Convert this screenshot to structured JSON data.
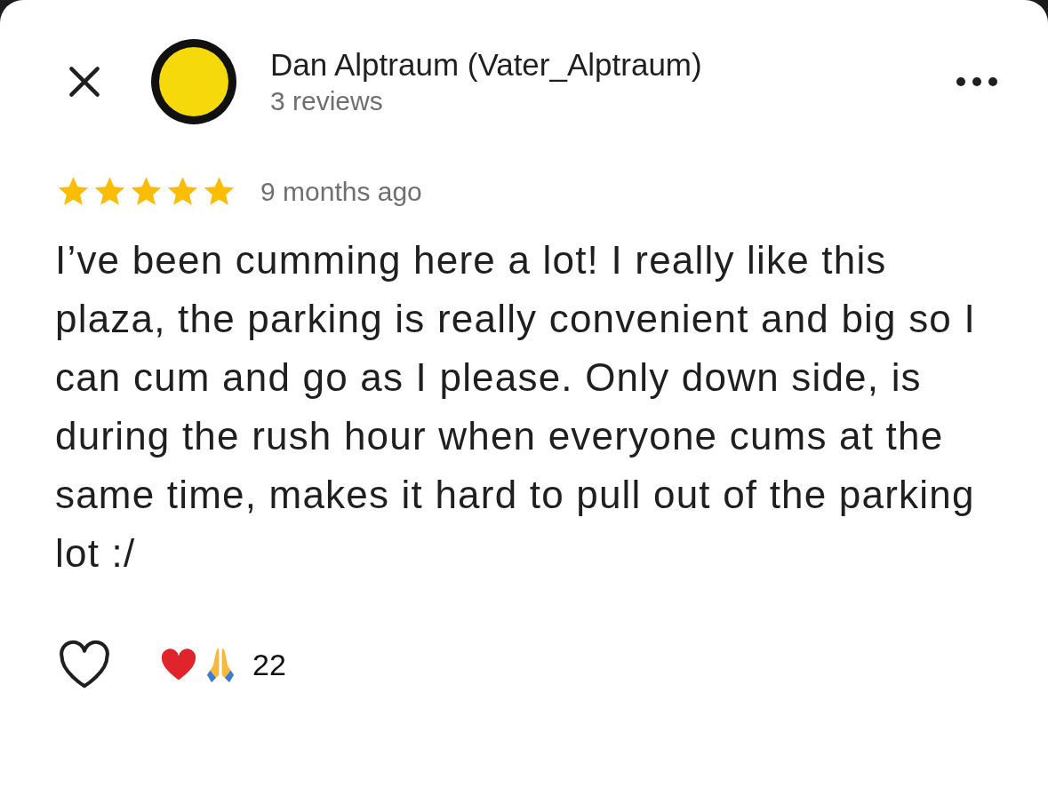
{
  "reviewer": {
    "name": "Dan Alptraum (Vater_Alptraum)",
    "reviews": "3 reviews"
  },
  "review": {
    "stars": 5,
    "time": "9 months ago",
    "text": "I’ve been cumming here a lot! I really like this plaza, the parking is really convenient and big so I can cum and go as I please. Only down side, is during the rush hour when everyone cums at the same time, makes it hard to pull out of the parking lot :/"
  },
  "reactions": {
    "liked": false,
    "count": "22"
  }
}
